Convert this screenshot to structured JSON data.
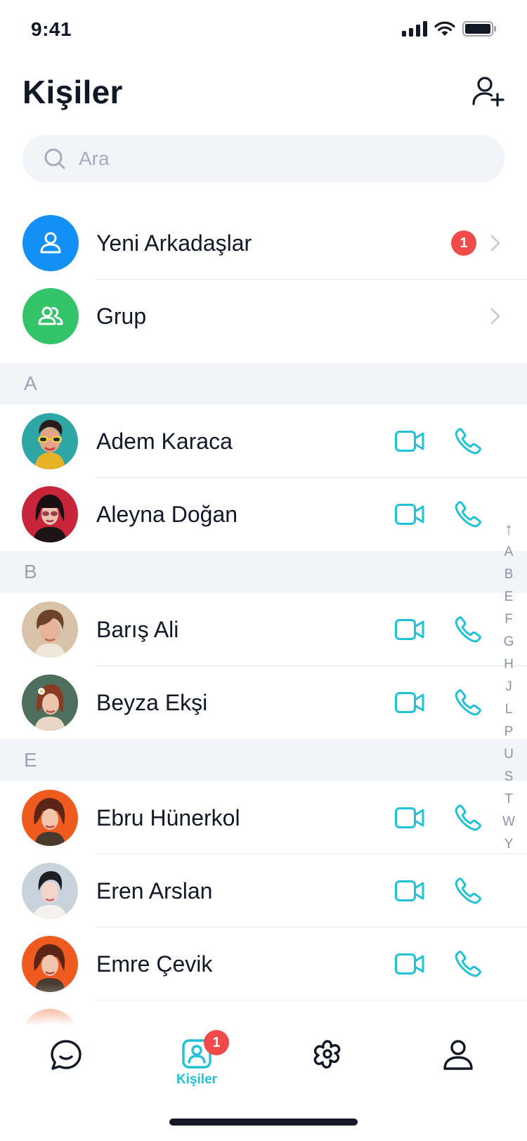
{
  "status_bar": {
    "time": "9:41"
  },
  "header": {
    "title": "Kişiler"
  },
  "search": {
    "placeholder": "Ara"
  },
  "special_rows": [
    {
      "label": "Yeni Arkadaşlar",
      "badge": "1",
      "icon": "user-icon",
      "color": "#1290f6"
    },
    {
      "label": "Grup",
      "icon": "group-icon",
      "color": "#33c46a"
    }
  ],
  "sections": [
    {
      "letter": "A",
      "contacts": [
        {
          "name": "Adem Karaca"
        },
        {
          "name": "Aleyna Doğan"
        }
      ]
    },
    {
      "letter": "B",
      "contacts": [
        {
          "name": "Barış Ali"
        },
        {
          "name": "Beyza Ekşi"
        }
      ]
    },
    {
      "letter": "E",
      "contacts": [
        {
          "name": "Ebru Hünerkol"
        },
        {
          "name": "Eren Arslan"
        },
        {
          "name": "Emre Çevik"
        }
      ]
    }
  ],
  "alphabet_index": [
    "↑",
    "A",
    "B",
    "E",
    "F",
    "G",
    "H",
    "J",
    "L",
    "P",
    "U",
    "S",
    "T",
    "W",
    "Y"
  ],
  "tab_bar": {
    "tabs": [
      {
        "name": "chats",
        "icon": "chat-icon"
      },
      {
        "name": "contacts",
        "icon": "contacts-icon",
        "label": "Kişiler",
        "badge": "1",
        "active": true
      },
      {
        "name": "discover",
        "icon": "flower-icon"
      },
      {
        "name": "profile",
        "icon": "profile-icon"
      }
    ]
  },
  "colors": {
    "accent": "#21c1d6",
    "badge": "#f04a4a",
    "text": "#121826",
    "section_bg": "#f3f4f8"
  }
}
